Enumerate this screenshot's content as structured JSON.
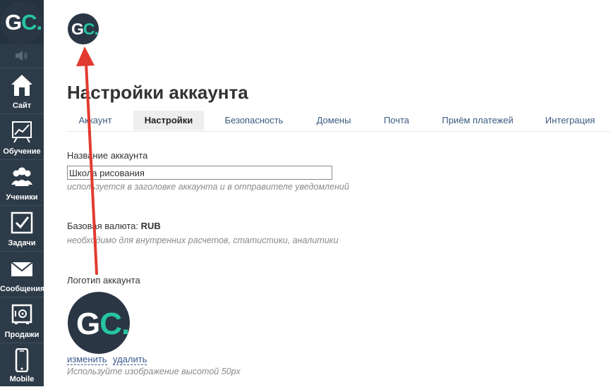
{
  "sidebar": {
    "logo": {
      "g": "G",
      "c": "C",
      "dot": "."
    },
    "items": [
      {
        "label": "Сайт",
        "icon": "house-icon"
      },
      {
        "label": "Обучение",
        "icon": "chart-board-icon"
      },
      {
        "label": "Ученики",
        "icon": "users-icon"
      },
      {
        "label": "Задачи",
        "icon": "checkbox-icon"
      },
      {
        "label": "Сообщения",
        "icon": "envelope-icon"
      },
      {
        "label": "Продажи",
        "icon": "safe-icon"
      },
      {
        "label": "Mobile",
        "icon": "phone-icon"
      }
    ]
  },
  "header": {
    "logo": {
      "g": "G",
      "c": "C",
      "dot": "."
    },
    "title": "Настройки аккаунта"
  },
  "tabs": [
    {
      "label": "Аккаунт",
      "active": false
    },
    {
      "label": "Настройки",
      "active": true
    },
    {
      "label": "Безопасность",
      "active": false
    },
    {
      "label": "Домены",
      "active": false
    },
    {
      "label": "Почта",
      "active": false
    },
    {
      "label": "Приём платежей",
      "active": false
    },
    {
      "label": "Интеграция",
      "active": false
    }
  ],
  "form": {
    "account_name": {
      "label": "Название аккаунта",
      "value": "Школа рисования",
      "hint": "используется в заголовке аккаунта и в отправителе уведомлений"
    },
    "currency": {
      "label": "Базовая валюта: ",
      "value": "RUB",
      "hint": "необходимо для внутренних расчетов, статистики, аналитики"
    },
    "logo": {
      "label": "Логотип аккаунта",
      "image": {
        "g": "G",
        "c": "C",
        "dot": "."
      },
      "change_link": "изменить",
      "delete_link": "удалить",
      "hint": "Используйте изображение высотой 50px"
    }
  },
  "colors": {
    "sidebar_bg": "#2d3a47",
    "logo_bg": "#2a3644",
    "logo_accent": "#26c4a3",
    "annotation_arrow": "#e23b30",
    "link": "#3a5a90"
  }
}
